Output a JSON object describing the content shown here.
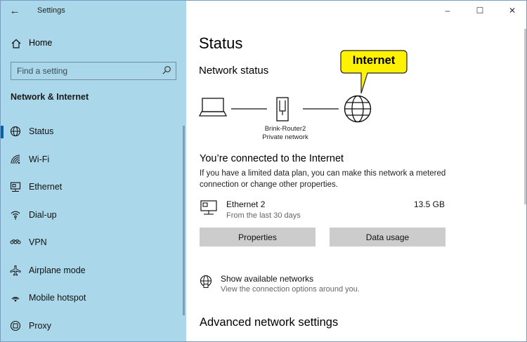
{
  "window": {
    "title": "Settings"
  },
  "window_controls": {
    "minimize": "–",
    "maximize": "☐",
    "close": "✕"
  },
  "sidebar": {
    "back_glyph": "←",
    "home_label": "Home",
    "search_placeholder": "Find a setting",
    "section_title": "Network & Internet",
    "items": [
      {
        "label": "Status",
        "icon": "status-icon",
        "selected": true
      },
      {
        "label": "Wi-Fi",
        "icon": "wifi-icon"
      },
      {
        "label": "Ethernet",
        "icon": "ethernet-icon"
      },
      {
        "label": "Dial-up",
        "icon": "dialup-icon"
      },
      {
        "label": "VPN",
        "icon": "vpn-icon"
      },
      {
        "label": "Airplane mode",
        "icon": "airplane-icon"
      },
      {
        "label": "Mobile hotspot",
        "icon": "hotspot-icon"
      },
      {
        "label": "Proxy",
        "icon": "proxy-icon"
      }
    ]
  },
  "main": {
    "page_title": "Status",
    "network_status_heading": "Network status",
    "router_name": "Brink-Router2",
    "router_network": "Private network",
    "callout": "Internet",
    "connected_title": "You’re connected to the Internet",
    "connected_desc": "If you have a limited data plan, you can make this network a metered connection or change other properties.",
    "adapter": {
      "name": "Ethernet 2",
      "period": "From the last 30 days",
      "usage": "13.5 GB"
    },
    "properties_button": "Properties",
    "data_usage_button": "Data usage",
    "show_networks": {
      "title": "Show available networks",
      "subtitle": "View the connection options around you."
    },
    "advanced_heading": "Advanced network settings"
  },
  "colors": {
    "sidebar_bg": "#aad8ea",
    "accent": "#0063b1",
    "button_bg": "#cccccc",
    "callout_bg": "#fff200"
  }
}
